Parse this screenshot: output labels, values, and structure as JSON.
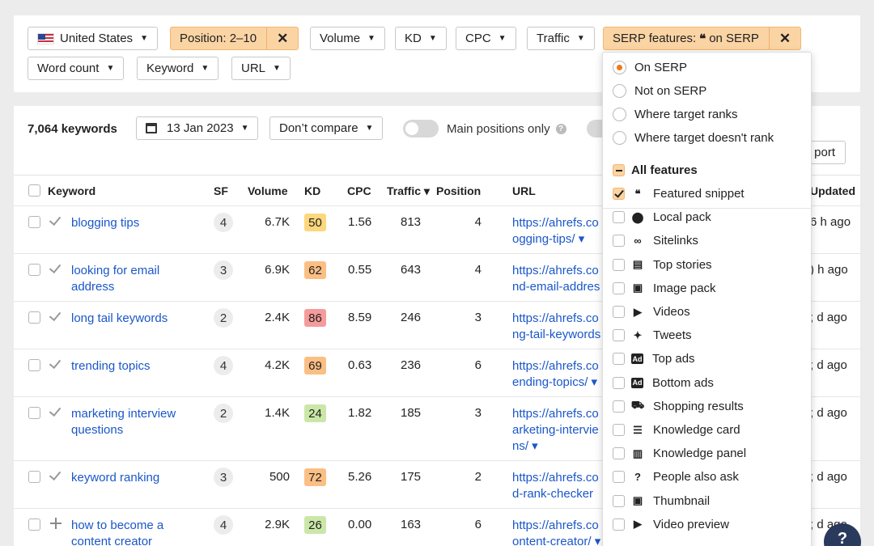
{
  "filters": {
    "country": "United States",
    "position": "Position: 2–10",
    "volume": "Volume",
    "kd": "KD",
    "cpc": "CPC",
    "traffic": "Traffic",
    "serp_prefix": "SERP features:",
    "serp_quote": "❝",
    "serp_suffix": "on SERP",
    "word_count": "Word count",
    "keyword": "Keyword",
    "url": "URL"
  },
  "toolbar": {
    "keyword_count": "7,064 keywords",
    "date": "13 Jan 2023",
    "compare": "Don’t compare",
    "main_positions": "Main positions only",
    "export": "port"
  },
  "table": {
    "headers": {
      "keyword": "Keyword",
      "sf": "SF",
      "volume": "Volume",
      "kd": "KD",
      "cpc": "CPC",
      "traffic": "Traffic ▾",
      "position": "Position",
      "url": "URL",
      "updated": "Updated"
    },
    "rows": [
      {
        "kw1": "blogging tips",
        "kw2": "",
        "sf": "4",
        "volume": "6.7K",
        "kd": "50",
        "kd_color": "#fcd77c",
        "cpc": "1.56",
        "traffic": "813",
        "position": "4",
        "url1": "https://ahrefs.co",
        "url2": "ogging-tips/ ▾",
        "url3": "",
        "updated": "6 h ago",
        "icon": "tick"
      },
      {
        "kw1": "looking for email",
        "kw2": "address",
        "sf": "3",
        "volume": "6.9K",
        "kd": "62",
        "kd_color": "#fbbf84",
        "cpc": "0.55",
        "traffic": "643",
        "position": "4",
        "url1": "https://ahrefs.co",
        "url2": "nd-email-addres",
        "url3": "",
        "updated": ") h ago",
        "icon": "tick"
      },
      {
        "kw1": "long tail keywords",
        "kw2": "",
        "sf": "2",
        "volume": "2.4K",
        "kd": "86",
        "kd_color": "#f59b9b",
        "cpc": "8.59",
        "traffic": "246",
        "position": "3",
        "url1": "https://ahrefs.co",
        "url2": "ng-tail-keywords",
        "url3": "",
        "updated": "; d ago",
        "icon": "tick"
      },
      {
        "kw1": "trending topics",
        "kw2": "",
        "sf": "4",
        "volume": "4.2K",
        "kd": "69",
        "kd_color": "#fbbf84",
        "cpc": "0.63",
        "traffic": "236",
        "position": "6",
        "url1": "https://ahrefs.co",
        "url2": "ending-topics/ ▾",
        "url3": "",
        "updated": "; d ago",
        "icon": "tick"
      },
      {
        "kw1": "marketing interview",
        "kw2": "questions",
        "sf": "2",
        "volume": "1.4K",
        "kd": "24",
        "kd_color": "#cbe7a8",
        "cpc": "1.82",
        "traffic": "185",
        "position": "3",
        "url1": "https://ahrefs.co",
        "url2": "arketing-intervie",
        "url3": "ns/ ▾",
        "updated": "; d ago",
        "icon": "tick"
      },
      {
        "kw1": "keyword ranking",
        "kw2": "",
        "sf": "3",
        "volume": "500",
        "kd": "72",
        "kd_color": "#fbbf84",
        "cpc": "5.26",
        "traffic": "175",
        "position": "2",
        "url1": "https://ahrefs.co",
        "url2": "d-rank-checker",
        "url3": "",
        "updated": "; d ago",
        "icon": "tick"
      },
      {
        "kw1": "how to become a",
        "kw2": "content creator",
        "sf": "4",
        "volume": "2.9K",
        "kd": "26",
        "kd_color": "#cbe7a8",
        "cpc": "0.00",
        "traffic": "163",
        "position": "6",
        "url1": "https://ahrefs.co",
        "url2": "ontent-creator/ ▾",
        "url3": "",
        "updated": "; d ago",
        "icon": "plus"
      }
    ]
  },
  "dropdown": {
    "radios": [
      "On SERP",
      "Not on SERP",
      "Where target ranks",
      "Where target doesn't rank"
    ],
    "all_features": "All features",
    "features": [
      {
        "label": "Featured snippet",
        "icon": "❝",
        "checked": true
      },
      {
        "label": "Local pack",
        "icon": "⬤",
        "checked": false
      },
      {
        "label": "Sitelinks",
        "icon": "∞",
        "checked": false
      },
      {
        "label": "Top stories",
        "icon": "▤",
        "checked": false
      },
      {
        "label": "Image pack",
        "icon": "▣",
        "checked": false
      },
      {
        "label": "Videos",
        "icon": "▶",
        "checked": false
      },
      {
        "label": "Tweets",
        "icon": "✦",
        "checked": false
      },
      {
        "label": "Top ads",
        "icon": "Ad",
        "checked": false
      },
      {
        "label": "Bottom ads",
        "icon": "Ad",
        "checked": false
      },
      {
        "label": "Shopping results",
        "icon": "⛟",
        "checked": false
      },
      {
        "label": "Knowledge card",
        "icon": "☰",
        "checked": false
      },
      {
        "label": "Knowledge panel",
        "icon": "▥",
        "checked": false
      },
      {
        "label": "People also ask",
        "icon": "?",
        "checked": false
      },
      {
        "label": "Thumbnail",
        "icon": "▣",
        "checked": false
      },
      {
        "label": "Video preview",
        "icon": "▶",
        "checked": false
      }
    ]
  },
  "help": "?"
}
